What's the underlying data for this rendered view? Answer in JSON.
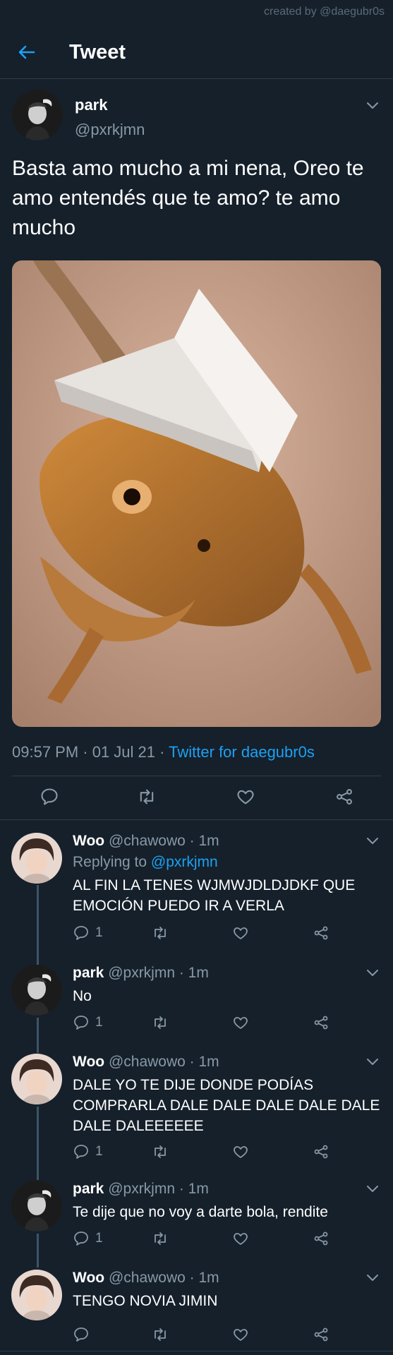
{
  "watermark": "created by @daegubr0s",
  "header": {
    "title": "Tweet"
  },
  "main_tweet": {
    "name": "park",
    "handle": "@pxrkjmn",
    "text": "Basta amo mucho a mi nena, Oreo te amo entendés que te amo? te amo mucho",
    "time": "09:57 PM · 01 Jul 21 · ",
    "client": "Twitter for daegubr0s"
  },
  "replies": [
    {
      "name": "Woo",
      "meta": " @chawowo · 1m",
      "replying_prefix": "Replying to ",
      "replying_to": "@pxrkjmn",
      "text": "AL FIN LA TENES WJMWJDLDJDKF QUE EMOCIÓN PUEDO IR A VERLA",
      "reply_count": "1"
    },
    {
      "name": "park",
      "meta": " @pxrkjmn · 1m",
      "text": "No",
      "reply_count": "1"
    },
    {
      "name": "Woo",
      "meta": " @chawowo · 1m",
      "text": "DALE YO TE DIJE DONDE PODÍAS COMPRARLA DALE DALE DALE DALE DALE DALE DALEEEEEE",
      "reply_count": "1"
    },
    {
      "name": "park",
      "meta": " @pxrkjmn · 1m",
      "text": "Te dije que no voy a darte bola, rendite",
      "reply_count": "1"
    },
    {
      "name": "Woo",
      "meta": " @chawowo · 1m",
      "text": "TENGO NOVIA JIMIN",
      "reply_count": ""
    }
  ],
  "colors": {
    "background": "#15202b",
    "accent": "#1da1f2",
    "secondary_text": "#8899a6",
    "divider": "#2f3d4a"
  },
  "icons": [
    "back-arrow-icon",
    "chevron-down-icon",
    "reply-icon",
    "retweet-icon",
    "like-icon",
    "share-icon"
  ]
}
